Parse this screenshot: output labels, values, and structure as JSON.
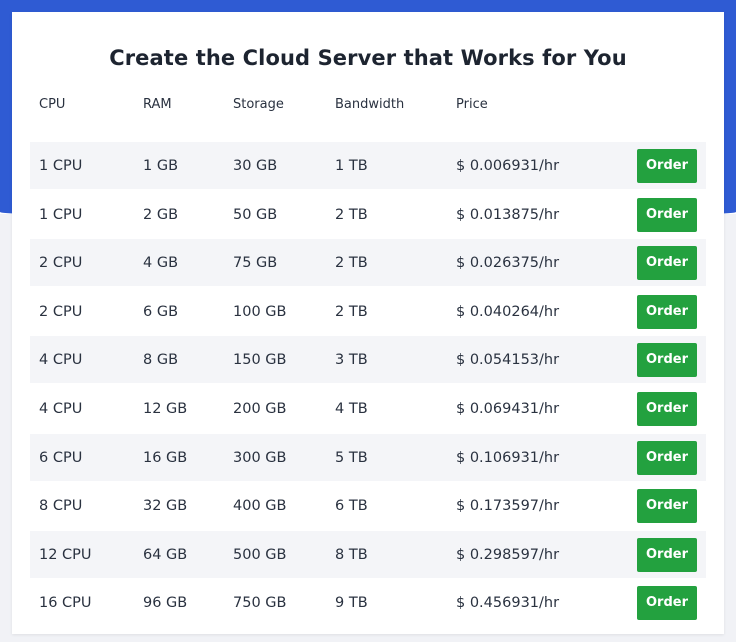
{
  "title": "Create the Cloud Server that Works for You",
  "columns": {
    "cpu": "CPU",
    "ram": "RAM",
    "storage": "Storage",
    "bandwidth": "Bandwidth",
    "price": "Price"
  },
  "plans": [
    {
      "cpu": "1 CPU",
      "ram": "1 GB",
      "storage": "30 GB",
      "bandwidth": "1 TB",
      "price": "$ 0.006931/hr",
      "button": "Order"
    },
    {
      "cpu": "1 CPU",
      "ram": "2 GB",
      "storage": "50 GB",
      "bandwidth": "2 TB",
      "price": "$ 0.013875/hr",
      "button": "Order"
    },
    {
      "cpu": "2 CPU",
      "ram": "4 GB",
      "storage": "75 GB",
      "bandwidth": "2 TB",
      "price": "$ 0.026375/hr",
      "button": "Order"
    },
    {
      "cpu": "2 CPU",
      "ram": "6 GB",
      "storage": "100 GB",
      "bandwidth": "2 TB",
      "price": "$ 0.040264/hr",
      "button": "Order"
    },
    {
      "cpu": "4 CPU",
      "ram": "8 GB",
      "storage": "150 GB",
      "bandwidth": "3 TB",
      "price": "$ 0.054153/hr",
      "button": "Order"
    },
    {
      "cpu": "4 CPU",
      "ram": "12 GB",
      "storage": "200 GB",
      "bandwidth": "4 TB",
      "price": "$ 0.069431/hr",
      "button": "Order"
    },
    {
      "cpu": "6 CPU",
      "ram": "16 GB",
      "storage": "300 GB",
      "bandwidth": "5 TB",
      "price": "$ 0.106931/hr",
      "button": "Order"
    },
    {
      "cpu": "8 CPU",
      "ram": "32 GB",
      "storage": "400 GB",
      "bandwidth": "6 TB",
      "price": "$ 0.173597/hr",
      "button": "Order"
    },
    {
      "cpu": "12 CPU",
      "ram": "64 GB",
      "storage": "500 GB",
      "bandwidth": "8 TB",
      "price": "$ 0.298597/hr",
      "button": "Order"
    },
    {
      "cpu": "16 CPU",
      "ram": "96 GB",
      "storage": "750 GB",
      "bandwidth": "9 TB",
      "price": "$ 0.456931/hr",
      "button": "Order"
    }
  ],
  "colors": {
    "header_background": "#2f5bd3",
    "order_button": "#23a13f",
    "striped_row": "#f4f5f8"
  }
}
